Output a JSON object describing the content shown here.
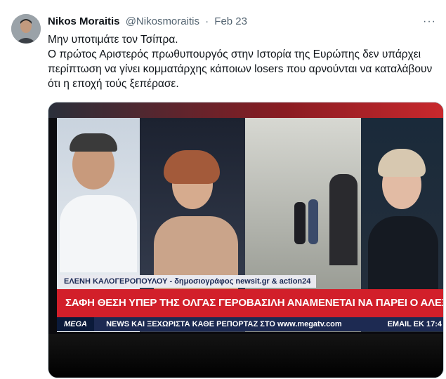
{
  "tweet": {
    "name": "Nikos Moraitis",
    "handle": "@Nikosmoraitis",
    "separator": "·",
    "date": "Feb 23",
    "more": "···",
    "lines": [
      "Μην υποτιμάτε τον Τσίπρα.",
      "Ο πρώτος Αριστερός πρωθυπουργός στην Ιστορία της Ευρώπης δεν υπάρχει περίπτωση να γίνει κομματάρχης κάποιων losers που αρνούνται να καταλάβουν ότι η εποχή τούς ξεπέρασε."
    ]
  },
  "media": {
    "caption_name": "ΕΛΕΝΗ ΚΑΛΟΓΕΡΟΠΟΥΛΟΥ - δημοσιογράφος newsit.gr & action24",
    "headline": "ΣΑΦΗ ΘΕΣΗ ΥΠΕΡ ΤΗΣ ΟΛΓΑΣ ΓΕΡΟΒΑΣΙΛΗ ΑΝΑΜΕΝΕΤΑΙ ΝΑ ΠΑΡΕΙ Ο ΑΛΕΞΗΣ ΤΣΙΠΡΑΣ",
    "channel": "ΜΕGΑ",
    "ticker": "NEWS ΚΑΙ ΞΕΧΩΡΙΣΤΑ ΚΑΘΕ ΡΕΠΟΡΤΑΖ ΣΤΟ www.megatv.com",
    "ticker_right": "EMAIL EK 17:4"
  },
  "colors": {
    "accent_red": "#d21f2a",
    "ticker_blue": "#1d2a52"
  }
}
